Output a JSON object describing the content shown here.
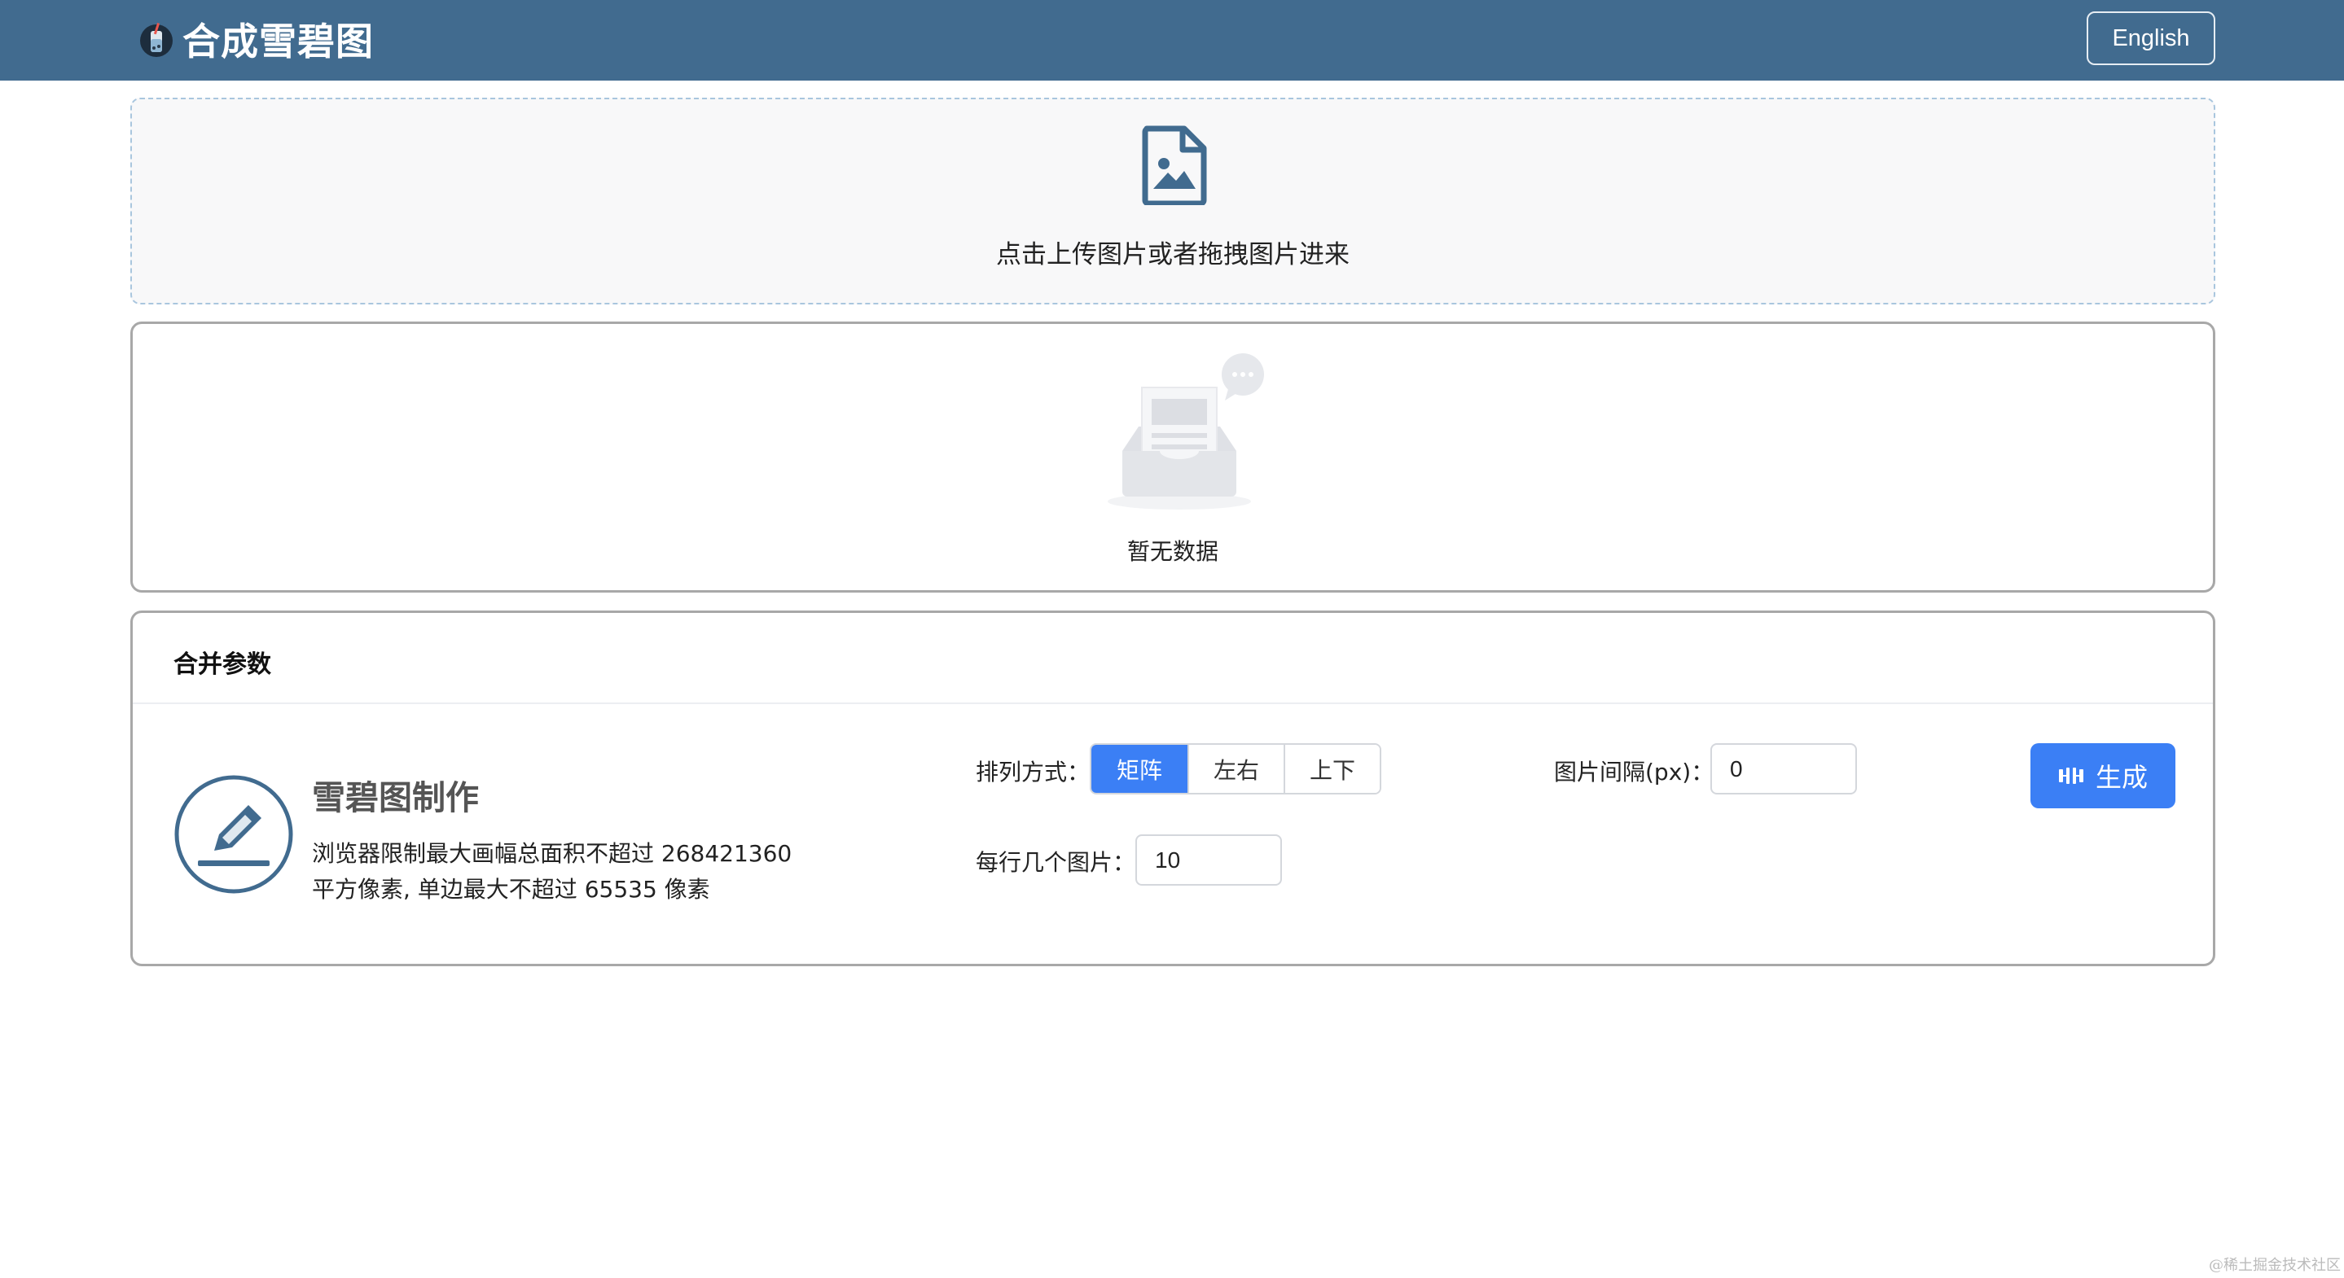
{
  "header": {
    "title": "合成雪碧图",
    "lang_button": "English"
  },
  "upload": {
    "text": "点击上传图片或者拖拽图片进来",
    "icon": "file-image-icon"
  },
  "image_list": {
    "empty_text": "暂无数据",
    "icon": "empty-inbox-icon"
  },
  "params": {
    "title": "合并参数",
    "intro": {
      "title": "雪碧图制作",
      "desc_line1": "浏览器限制最大画幅总面积不超过 268421360",
      "desc_line2": "平方像素, 单边最大不超过 65535 像素",
      "icon": "pencil-icon"
    },
    "layout_label": "排列方式：",
    "layout_options": [
      "矩阵",
      "左右",
      "上下"
    ],
    "layout_selected": "矩阵",
    "gap_label": "图片间隔(px)：",
    "gap_value": "0",
    "per_row_label": "每行几个图片：",
    "per_row_value": "10",
    "generate_button": "生成",
    "generate_icon": "merge-icon"
  },
  "watermark": "@稀土掘金技术社区",
  "colors": {
    "header_bg": "#416b8f",
    "primary": "#3b7ff5",
    "upload_icon": "#416b8f"
  }
}
